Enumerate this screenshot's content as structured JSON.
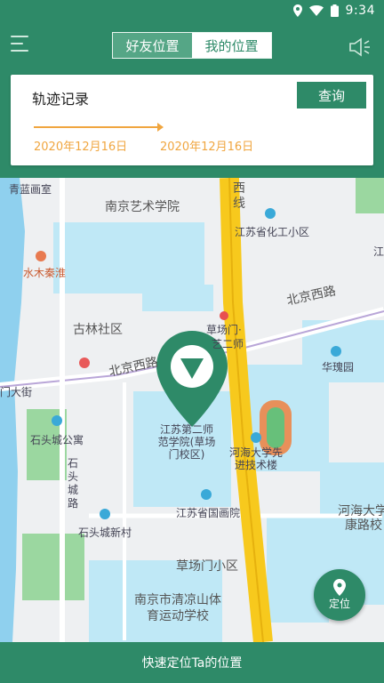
{
  "status": {
    "time": "9:34"
  },
  "header": {
    "tabs": [
      {
        "label": "好友位置"
      },
      {
        "label": "我的位置"
      }
    ]
  },
  "track_card": {
    "title": "轨迹记录",
    "query_label": "查询",
    "start_date": "2020年12月16日",
    "end_date": "2020年12月16日"
  },
  "map": {
    "labels": {
      "qinglan": "青蓝画室",
      "art": "南京艺术学院",
      "xixian": "西线",
      "chem": "江苏省化工小区",
      "jiang": "江",
      "shuimu": "水木秦淮",
      "beijingxi_r": "北京西路",
      "gulin": "古林社区",
      "caochang": "草场门·",
      "erlshi": "艺二师",
      "huaguiyuan": "华瑰园",
      "beijingxi_l": "北京西路",
      "menda": "门大街",
      "school": "江苏第二师范学院(草场门校区)",
      "shitou_gy": "石头城公寓",
      "hehai_tech": "河海大学先进技术楼",
      "shitou_road": "石头城路",
      "jshuayuan": "江苏省国画院",
      "shitou_xc": "石头城新村",
      "hehai": "河海大学",
      "kanglu": "康路校",
      "caochangmen": "草场门小区",
      "qingliang": "南京市清凉山体育运动学校"
    }
  },
  "locate_label": "定位",
  "bottom_bar": "快速定位Ta的位置"
}
